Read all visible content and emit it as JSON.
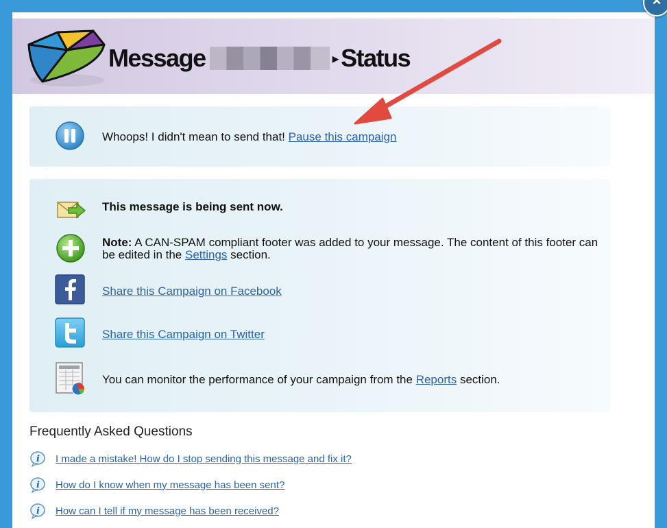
{
  "window": {
    "close_label": "×"
  },
  "header": {
    "title_prefix": "Message",
    "caret": "▸",
    "title_suffix": "Status"
  },
  "pause": {
    "text": "Whoops! I didn't mean to send that!",
    "link": "Pause this campaign"
  },
  "status_rows": {
    "sending": "This message is being sent now.",
    "note_label": "Note:",
    "note_text": "A CAN-SPAM compliant footer was added to your message. The content of this footer can be edited in the",
    "note_link": "Settings",
    "note_suffix": "section.",
    "facebook_link": "Share this Campaign on Facebook",
    "twitter_link": "Share this Campaign on Twitter",
    "reports_text": "You can monitor the performance of your campaign from the",
    "reports_link": "Reports",
    "reports_suffix": "section."
  },
  "faq": {
    "title": "Frequently Asked Questions",
    "items": [
      {
        "label": "I made a mistake! How do I stop sending this message and fix it?"
      },
      {
        "label": "How do I know when my message has been sent?"
      },
      {
        "label": "How can I tell if my message has been received?"
      }
    ]
  },
  "colors": {
    "frame": "#3a9ad9",
    "link": "#2a63a8",
    "annotation_arrow": "#e04a3f"
  }
}
